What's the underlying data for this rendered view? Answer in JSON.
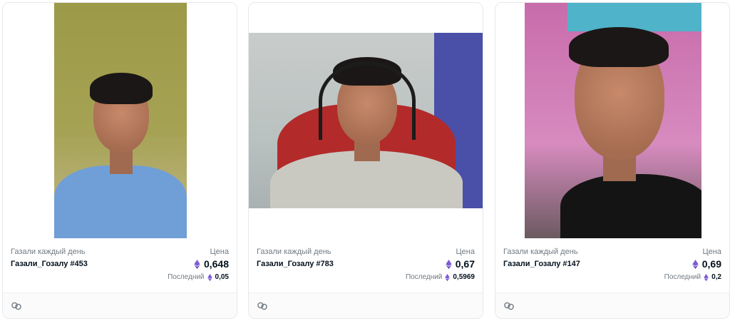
{
  "cards": [
    {
      "collection": "Газали каждый день",
      "name": "Газали_Гозалу #453",
      "price_label": "Цена",
      "price": "0,648",
      "last_label": "Последний",
      "last_price": "0,05",
      "currency_icon": "ethereum-icon",
      "footer_icon": "link-icon"
    },
    {
      "collection": "Газали каждый день",
      "name": "Газали_Гозалу #783",
      "price_label": "Цена",
      "price": "0,67",
      "last_label": "Последний",
      "last_price": "0,5969",
      "currency_icon": "ethereum-icon",
      "footer_icon": "link-icon"
    },
    {
      "collection": "Газали каждый день",
      "name": "Газали_Гозалу #147",
      "price_label": "Цена",
      "price": "0,69",
      "last_label": "Последний",
      "last_price": "0,2",
      "currency_icon": "ethereum-icon",
      "footer_icon": "link-icon"
    }
  ],
  "colors": {
    "eth_purple": "#7b5bd6",
    "text_dark": "#04111d",
    "text_muted": "#707a83"
  }
}
